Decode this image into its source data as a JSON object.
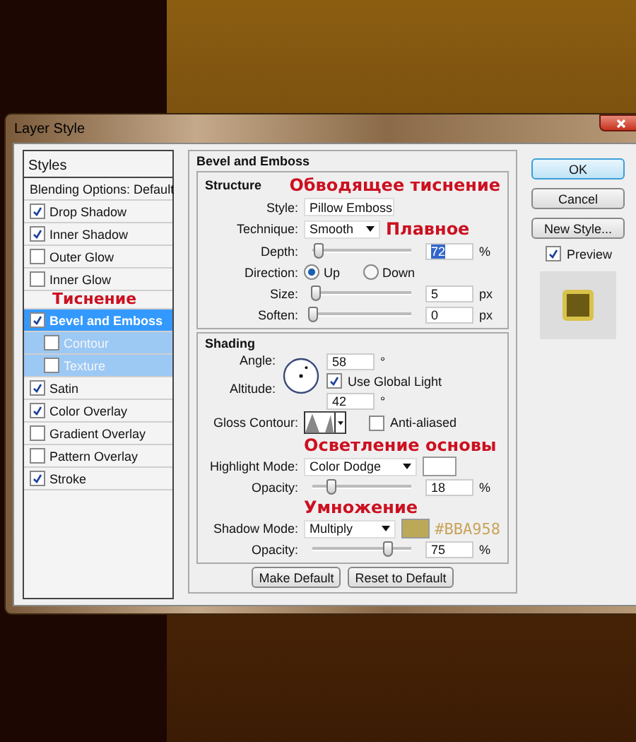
{
  "window": {
    "title": "Layer Style"
  },
  "styles_panel": {
    "title": "Styles",
    "items": [
      {
        "label": "Blending Options: Default",
        "kind": "plain",
        "selected": false
      },
      {
        "label": "Drop Shadow",
        "kind": "check",
        "checked": true,
        "selected": false
      },
      {
        "label": "Inner Shadow",
        "kind": "check",
        "checked": true,
        "selected": false
      },
      {
        "label": "Outer Glow",
        "kind": "check",
        "checked": false,
        "selected": false
      },
      {
        "label": "Inner Glow",
        "kind": "check",
        "checked": false,
        "selected": false
      },
      {
        "label": "Bevel and Emboss",
        "kind": "check",
        "checked": true,
        "selected": true,
        "annotation": "Тиснение",
        "children": [
          {
            "label": "Contour",
            "kind": "check",
            "checked": false,
            "selected": false
          },
          {
            "label": "Texture",
            "kind": "check",
            "checked": false,
            "selected": false
          }
        ]
      },
      {
        "label": "Satin",
        "kind": "check",
        "checked": true,
        "selected": false
      },
      {
        "label": "Color Overlay",
        "kind": "check",
        "checked": true,
        "selected": false
      },
      {
        "label": "Gradient Overlay",
        "kind": "check",
        "checked": false,
        "selected": false
      },
      {
        "label": "Pattern Overlay",
        "kind": "check",
        "checked": false,
        "selected": false
      },
      {
        "label": "Stroke",
        "kind": "check",
        "checked": true,
        "selected": false
      }
    ]
  },
  "bevel_and_emboss": {
    "title": "Bevel and Emboss",
    "structure": {
      "title": "Structure",
      "annotation": "Обводящее тиснение",
      "style": {
        "label": "Style:",
        "value": "Pillow Emboss"
      },
      "technique": {
        "label": "Technique:",
        "value": "Smooth",
        "annotation": "Плавное"
      },
      "depth": {
        "label": "Depth:",
        "level": 0.05,
        "value": "72",
        "unit": "%",
        "highlighted": true
      },
      "direction": {
        "label": "Direction:",
        "options": [
          {
            "label": "Up",
            "selected": true
          },
          {
            "label": "Down",
            "selected": false
          }
        ]
      },
      "size": {
        "label": "Size:",
        "level": 0.03,
        "value": "5",
        "unit": "px"
      },
      "soften": {
        "label": "Soften:",
        "level": 0,
        "value": "0",
        "unit": "px"
      }
    },
    "shading": {
      "title": "Shading",
      "angle": {
        "label": "Angle:",
        "value": "58",
        "unit": "°"
      },
      "use_global_light": {
        "label": "Use Global Light",
        "checked": true
      },
      "altitude": {
        "label": "Altitude:",
        "value": "42",
        "unit": "°"
      },
      "gloss_contour": {
        "label": "Gloss Contour:"
      },
      "anti_aliased": {
        "label": "Anti-aliased",
        "checked": false
      },
      "highlight_mode": {
        "label": "Highlight Mode:",
        "value": "Color Dodge",
        "color": "#ffffff",
        "annotation": "Осветление основы"
      },
      "highlight_opacity": {
        "label": "Opacity:",
        "level": 0.18,
        "value": "18",
        "unit": "%"
      },
      "shadow_mode": {
        "label": "Shadow Mode:",
        "value": "Multiply",
        "color": "#bba958",
        "annotation": "Умножение",
        "color_note": "#BBA958"
      },
      "shadow_opacity": {
        "label": "Opacity:",
        "level": 0.75,
        "value": "75",
        "unit": "%"
      }
    },
    "buttons": [
      "Make Default",
      "Reset to Default"
    ]
  },
  "actions": {
    "buttons": [
      {
        "label": "OK",
        "kind": "default"
      },
      {
        "label": "Cancel",
        "kind": "normal"
      },
      {
        "label": "New Style...",
        "kind": "normal"
      }
    ],
    "preview": {
      "label": "Preview",
      "checked": true
    }
  }
}
